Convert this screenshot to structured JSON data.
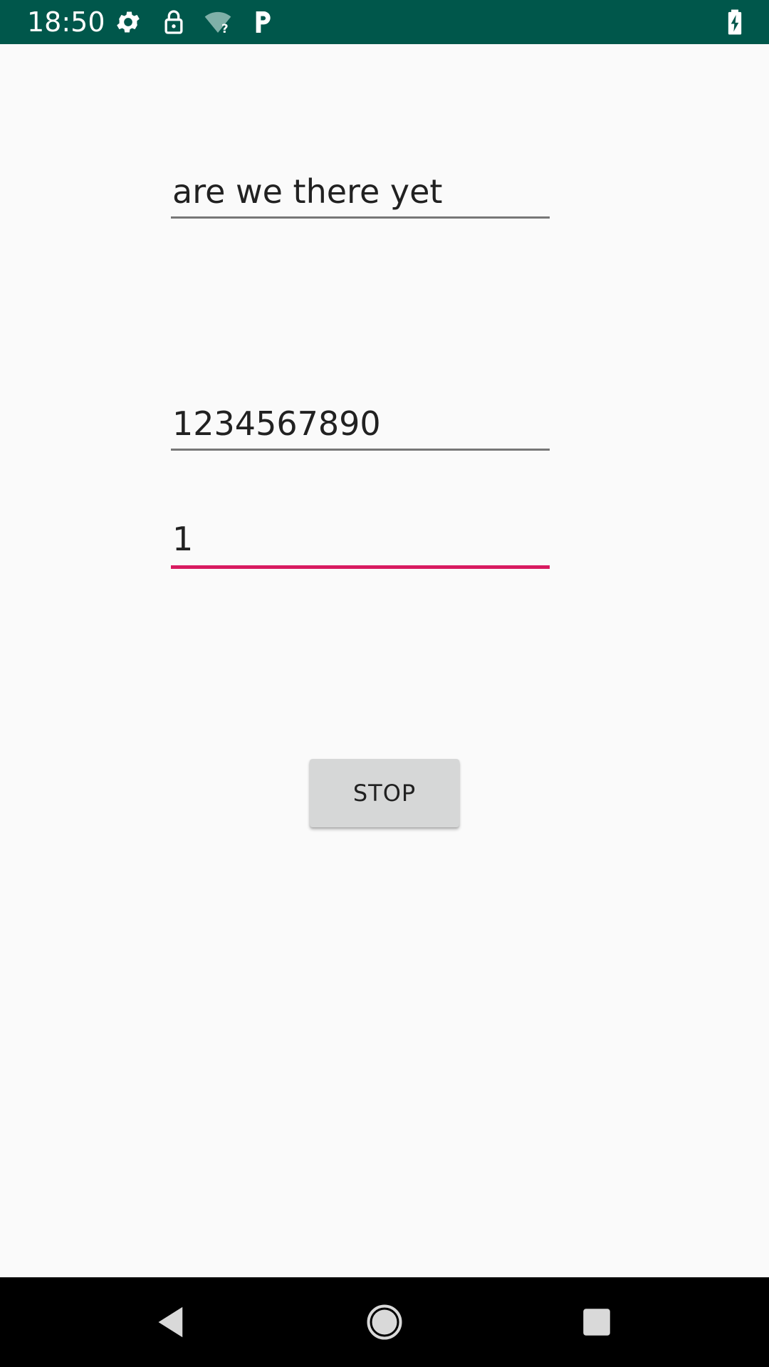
{
  "status_bar": {
    "time": "18:50",
    "background_color": "#00574b",
    "icons": [
      "gear-icon",
      "lock-icon",
      "wifi-unknown-icon",
      "parking-p-icon",
      "battery-charging-icon"
    ]
  },
  "form": {
    "field_1": {
      "value": "are we there yet"
    },
    "field_2": {
      "value": "1234567890"
    },
    "field_3": {
      "value": "1",
      "focused": true,
      "accent_color": "#d81b60"
    }
  },
  "stop_button": {
    "label": "STOP"
  },
  "nav_bar": {
    "buttons": [
      "back-icon",
      "home-icon",
      "recents-icon"
    ]
  }
}
